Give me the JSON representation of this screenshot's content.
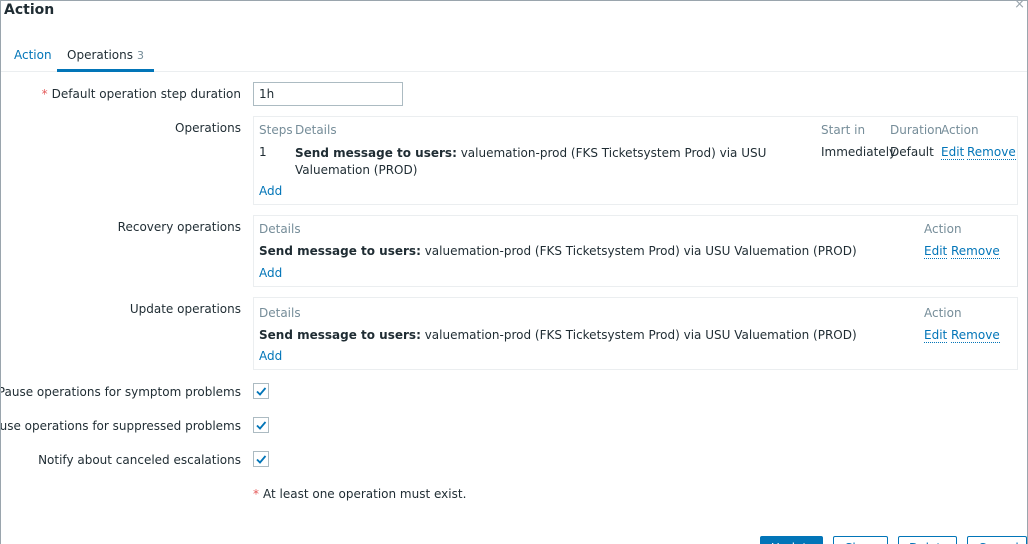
{
  "dialog": {
    "title": "Action",
    "close_glyph": "×"
  },
  "tabs": [
    {
      "label": "Action"
    },
    {
      "label": "Operations",
      "count": "3"
    }
  ],
  "form": {
    "step_duration": {
      "label": "Default operation step duration",
      "required_mark": "*",
      "value": "1h"
    },
    "operations": {
      "label": "Operations",
      "headers": {
        "steps": "Steps",
        "details": "Details",
        "start_in": "Start in",
        "duration": "Duration",
        "action": "Action"
      },
      "rows": [
        {
          "step": "1",
          "details_bold": "Send message to users:",
          "details_text": " valuemation-prod (FKS Ticketsystem Prod) via USU Valuemation (PROD)",
          "start_in": "Immediately",
          "duration": "Default",
          "edit": "Edit",
          "remove": "Remove"
        }
      ],
      "add": "Add"
    },
    "recovery": {
      "label": "Recovery operations",
      "headers": {
        "details": "Details",
        "action": "Action"
      },
      "row": {
        "details_bold": "Send message to users:",
        "details_text": " valuemation-prod (FKS Ticketsystem Prod) via USU Valuemation (PROD)",
        "edit": "Edit",
        "remove": "Remove"
      },
      "add": "Add"
    },
    "update": {
      "label": "Update operations",
      "headers": {
        "details": "Details",
        "action": "Action"
      },
      "row": {
        "details_bold": "Send message to users:",
        "details_text": " valuemation-prod (FKS Ticketsystem Prod) via USU Valuemation (PROD)",
        "edit": "Edit",
        "remove": "Remove"
      },
      "add": "Add"
    },
    "pause_symptom": {
      "label": "Pause operations for symptom problems",
      "checked": true
    },
    "pause_suppressed": {
      "label": "Pause operations for suppressed problems",
      "checked": true
    },
    "notify_canceled": {
      "label": "Notify about canceled escalations",
      "checked": true
    },
    "note": {
      "mark": "*",
      "text": "At least one operation must exist."
    }
  },
  "buttons": {
    "update": "Update",
    "clone": "Clone",
    "delete": "Delete",
    "cancel": "Cancel"
  },
  "colors": {
    "accent": "#0275b8",
    "required": "#e45959",
    "muted": "#768d99"
  }
}
